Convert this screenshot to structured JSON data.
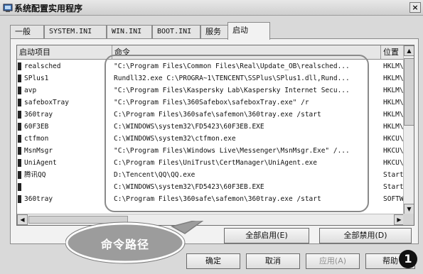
{
  "window": {
    "title": "系统配置实用程序",
    "close_label": "×"
  },
  "tabs": [
    "一般",
    "SYSTEM.INI",
    "WIN.INI",
    "BOOT.INI",
    "服务",
    "启动"
  ],
  "columns": {
    "item": "启动项目",
    "command": "命令",
    "location": "位置"
  },
  "rows": [
    {
      "name": "realsched",
      "command": "\"C:\\Program Files\\Common Files\\Real\\Update_OB\\realsched...",
      "location": "HKLM\\"
    },
    {
      "name": "SPlus1",
      "command": "Rundll32.exe C:\\PROGRA~1\\TENCENT\\SSPlus\\SPlus1.dll,Rund...",
      "location": "HKLM\\"
    },
    {
      "name": "avp",
      "command": "\"C:\\Program Files\\Kaspersky Lab\\Kaspersky Internet Secu...",
      "location": "HKLM\\"
    },
    {
      "name": "safeboxTray",
      "command": "\"C:\\Program Files\\360Safebox\\safeboxTray.exe\" /r",
      "location": "HKLM\\"
    },
    {
      "name": "360tray",
      "command": "C:\\Program Files\\360safe\\safemon\\360tray.exe /start",
      "location": "HKLM\\"
    },
    {
      "name": "60F3EB",
      "command": "C:\\WINDOWS\\system32\\FD5423\\60F3EB.EXE",
      "location": "HKLM\\"
    },
    {
      "name": "ctfmon",
      "command": "C:\\WINDOWS\\system32\\ctfmon.exe",
      "location": "HKCU\\"
    },
    {
      "name": "MsnMsgr",
      "command": "\"C:\\Program Files\\Windows Live\\Messenger\\MsnMsgr.Exe\" /...",
      "location": "HKCU\\"
    },
    {
      "name": "UniAgent",
      "command": "C:\\Program Files\\UniTrust\\CertManager\\UniAgent.exe",
      "location": "HKCU\\"
    },
    {
      "name": "腾讯QQ",
      "command": "D:\\Tencent\\QQ\\QQ.exe",
      "location": "Start"
    },
    {
      "name": "",
      "command": "C:\\WINDOWS\\system32\\FD5423\\60F3EB.EXE",
      "location": "Start"
    },
    {
      "name": "360tray",
      "command": "C:\\Program Files\\360safe\\safemon\\360tray.exe /start",
      "location": "SOFTW"
    }
  ],
  "buttons": {
    "enable_all": "全部启用(E)",
    "disable_all": "全部禁用(D)",
    "ok": "确定",
    "cancel": "取消",
    "apply": "应用(A)",
    "help": "帮助"
  },
  "callout": {
    "label": "命令路径"
  },
  "badge": "1"
}
